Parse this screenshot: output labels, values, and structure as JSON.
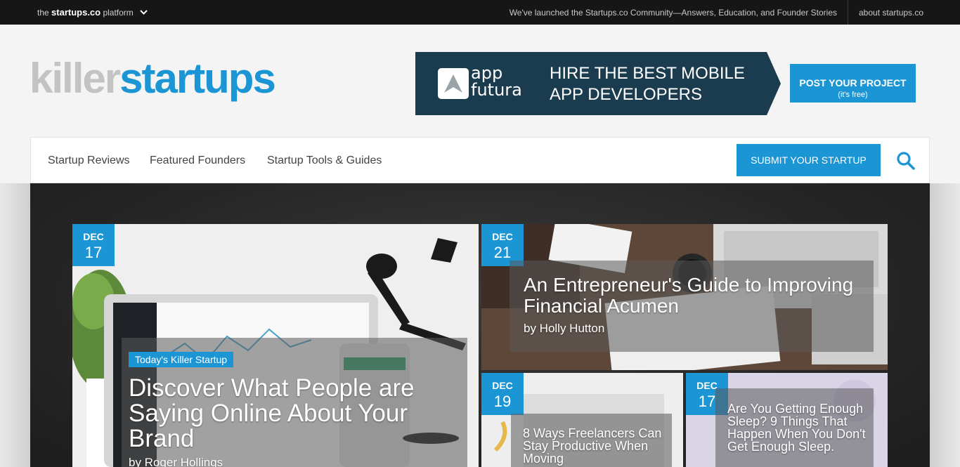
{
  "topbar": {
    "platform_prefix": "the",
    "platform_name": "startups.co",
    "platform_suffix": "platform",
    "announcement": "We've launched the Startups.co Community—Answers, Education, and Founder Stories",
    "about": "about startups.co"
  },
  "logo": {
    "part1": "killer",
    "part2": "startups"
  },
  "ad": {
    "brand_line1": "app",
    "brand_line2": "futura",
    "tagline_line1": "HIRE THE BEST MOBILE",
    "tagline_line2": "APP DEVELOPERS"
  },
  "post_button": {
    "label": "POST YOUR PROJECT",
    "sublabel": "(it's free)"
  },
  "nav": {
    "links": [
      "Startup Reviews",
      "Featured Founders",
      "Startup Tools & Guides"
    ],
    "submit_label": "SUBMIT YOUR STARTUP"
  },
  "articles": [
    {
      "month": "DEC",
      "day": "17",
      "badge": "Today's Killer Startup",
      "title": "Discover What People are Saying Online About Your Brand",
      "author": "by Roger Hollings"
    },
    {
      "month": "DEC",
      "day": "21",
      "title": "An Entrepreneur's Guide to Improving Financial Acumen",
      "author": "by Holly Hutton"
    },
    {
      "month": "DEC",
      "day": "19",
      "title": "8 Ways Freelancers Can Stay Productive When Moving"
    },
    {
      "month": "DEC",
      "day": "17",
      "title": "Are You Getting Enough Sleep? 9 Things That Happen When You Don't Get Enough Sleep."
    }
  ],
  "colors": {
    "accent": "#1b95d4",
    "topbar": "#161616",
    "ad_bg": "#1b3c4f"
  }
}
